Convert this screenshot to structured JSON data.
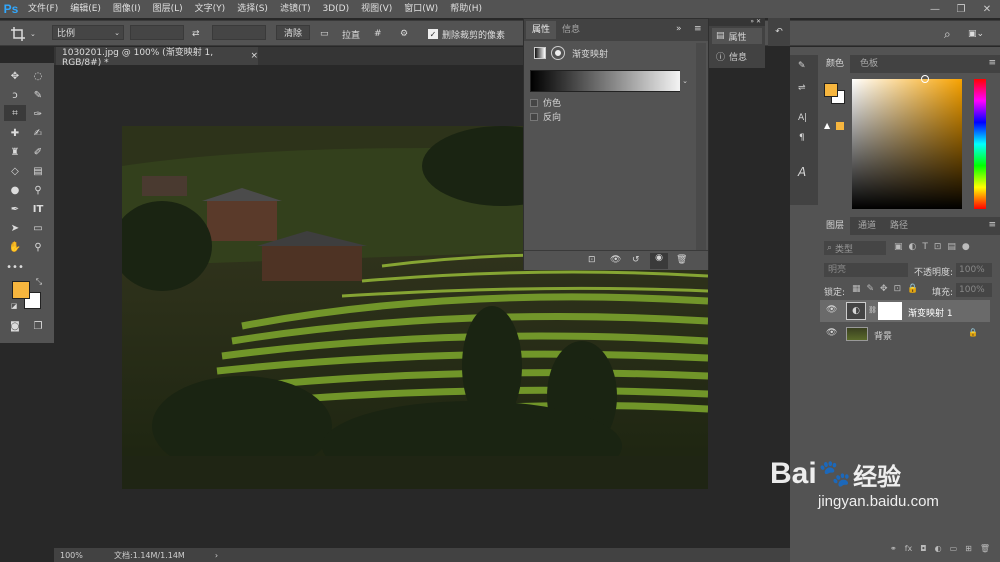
{
  "app": {
    "logo": "Ps"
  },
  "menu": [
    "文件(F)",
    "编辑(E)",
    "图像(I)",
    "图层(L)",
    "文字(Y)",
    "选择(S)",
    "滤镜(T)",
    "3D(D)",
    "视图(V)",
    "窗口(W)",
    "帮助(H)"
  ],
  "options": {
    "ratio_label": "比例",
    "clear_label": "清除",
    "straighten_label": "拉直",
    "delete_cropped_label": "删除裁剪的像素",
    "delete_cropped_checked": true
  },
  "document": {
    "tab_title": "1030201.jpg @ 100% (渐变映射 1, RGB/8#) *",
    "close": "×",
    "zoom": "100%",
    "doc_info": "文档:1.14M/1.14M",
    "status_arrow": "›"
  },
  "properties_panel": {
    "tab_properties": "属性",
    "tab_info": "信息",
    "title": "渐变映射",
    "checkbox_dither": "仿色",
    "checkbox_reverse": "反向",
    "dither_checked": false,
    "reverse_checked": false
  },
  "collapsed_panel": {
    "properties": "属性",
    "info": "信息"
  },
  "color_panel": {
    "tab_color": "颜色",
    "tab_swatches": "色板",
    "foreground": "#f7b63e",
    "background": "#ffffff"
  },
  "layers_panel": {
    "tab_layers": "图层",
    "tab_channels": "通道",
    "tab_paths": "路径",
    "kind_label": "类型",
    "blend_mode": "明亮",
    "opacity_label": "不透明度:",
    "opacity_value": "100%",
    "lock_label": "锁定:",
    "fill_label": "填充:",
    "fill_value": "100%",
    "layers": [
      {
        "name": "渐变映射 1",
        "selected": true
      },
      {
        "name": "背景",
        "selected": false
      }
    ]
  },
  "watermark": {
    "brand": "Bai",
    "brand2": "经验",
    "url": "jingyan.baidu.com"
  }
}
